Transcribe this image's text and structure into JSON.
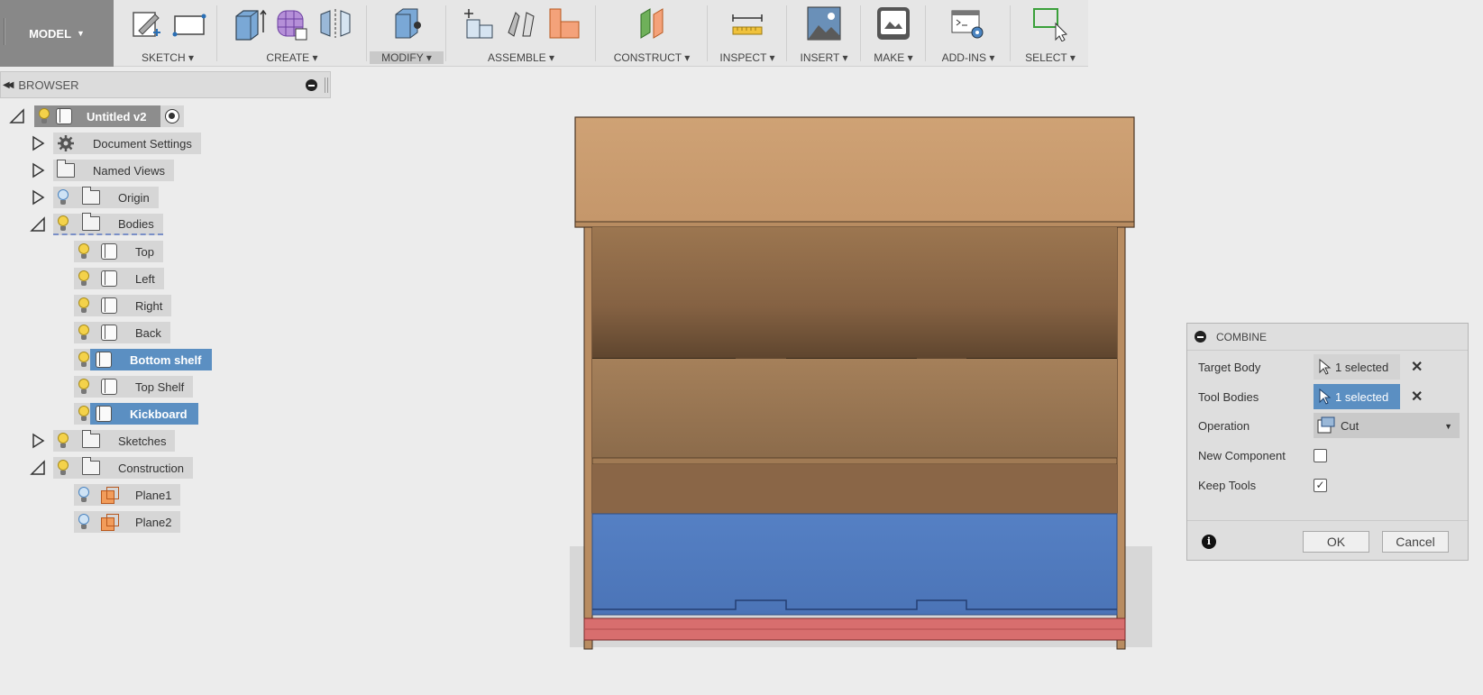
{
  "toolbar": {
    "mode": "MODEL",
    "groups": [
      {
        "label": "SKETCH"
      },
      {
        "label": "CREATE"
      },
      {
        "label": "MODIFY"
      },
      {
        "label": "ASSEMBLE"
      },
      {
        "label": "CONSTRUCT"
      },
      {
        "label": "INSPECT"
      },
      {
        "label": "INSERT"
      },
      {
        "label": "MAKE"
      },
      {
        "label": "ADD-INS"
      },
      {
        "label": "SELECT"
      }
    ],
    "caret": "▾"
  },
  "browser": {
    "title": "BROWSER",
    "root": "Untitled v2",
    "items": [
      {
        "label": "Document Settings"
      },
      {
        "label": "Named Views"
      },
      {
        "label": "Origin"
      },
      {
        "label": "Bodies"
      },
      {
        "label": "Top"
      },
      {
        "label": "Left"
      },
      {
        "label": "Right"
      },
      {
        "label": "Back"
      },
      {
        "label": "Bottom shelf"
      },
      {
        "label": "Top Shelf"
      },
      {
        "label": "Kickboard"
      },
      {
        "label": "Sketches"
      },
      {
        "label": "Construction"
      },
      {
        "label": "Plane1"
      },
      {
        "label": "Plane2"
      }
    ]
  },
  "combine": {
    "title": "COMBINE",
    "target_label": "Target Body",
    "target_value": "1 selected",
    "tool_label": "Tool Bodies",
    "tool_value": "1 selected",
    "operation_label": "Operation",
    "operation_value": "Cut",
    "new_component_label": "New Component",
    "new_component_checked": false,
    "keep_tools_label": "Keep Tools",
    "keep_tools_checked": true,
    "ok": "OK",
    "cancel": "Cancel"
  },
  "colors": {
    "wood": "#c99b6b",
    "highlight_blue": "#5b8fc2",
    "target_red": "#d86e6e"
  }
}
